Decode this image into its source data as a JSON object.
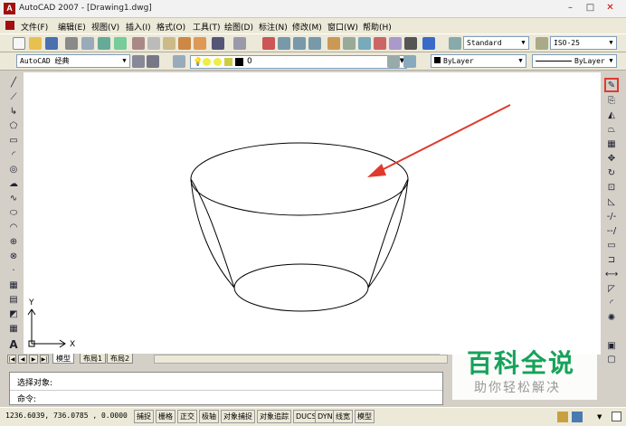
{
  "window": {
    "title": "AutoCAD 2007 - [Drawing1.dwg]",
    "minimize": "–",
    "maximize": "□",
    "close": "✕"
  },
  "menu": [
    "文件(F)",
    "编辑(E)",
    "视图(V)",
    "插入(I)",
    "格式(O)",
    "工具(T)",
    "绘图(D)",
    "标注(N)",
    "修改(M)",
    "窗口(W)",
    "帮助(H)"
  ],
  "toolbar": {
    "text_style": "Standard",
    "dim_style": "ISO-25",
    "workspace": "AutoCAD 经典",
    "layer": "0",
    "color": "ByLayer",
    "linetype": "ByLayer"
  },
  "canvas": {
    "ucs_x": "X",
    "ucs_y": "Y",
    "arrow_color": "#e03a2e"
  },
  "tabs": [
    "模型",
    "布局1",
    "布局2"
  ],
  "command": {
    "line1": "选择对象:",
    "line2": "命令:"
  },
  "status": {
    "coords": "1236.6039, 736.0785 , 0.0000",
    "buttons": [
      "捕捉",
      "栅格",
      "正交",
      "极轴",
      "对象捕捉",
      "对象追踪",
      "DUCS",
      "DYN",
      "线宽",
      "模型"
    ]
  },
  "watermark": {
    "logo": "百科全说",
    "subtitle": "助你轻松解决",
    "color": "#16a25a"
  }
}
